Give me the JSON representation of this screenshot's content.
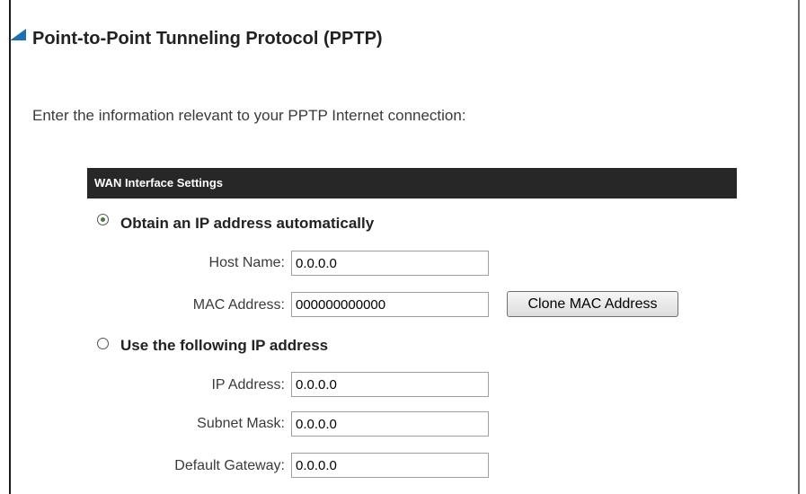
{
  "page": {
    "title": "Point-to-Point Tunneling Protocol (PPTP)",
    "intro": "Enter the information relevant to your PPTP Internet connection:"
  },
  "wan_settings": {
    "header": "WAN Interface Settings",
    "mode_options": [
      {
        "label": "Obtain an IP address automatically",
        "selected": true
      },
      {
        "label": "Use the following IP address",
        "selected": false
      }
    ],
    "auto_fields": {
      "host_name": {
        "label": "Host Name:",
        "value": "0.0.0.0"
      },
      "mac_address": {
        "label": "MAC Address:",
        "value": "000000000000"
      },
      "clone_button": "Clone MAC Address"
    },
    "static_fields": {
      "ip_address": {
        "label": "IP Address:",
        "value": "0.0.0.0"
      },
      "subnet_mask": {
        "label": "Subnet Mask:",
        "value": "0.0.0.0"
      },
      "default_gateway": {
        "label": "Default Gateway:",
        "value": "0.0.0.0"
      }
    }
  },
  "colors": {
    "section_bar": "#272727",
    "title_marker": "#1e6fb4",
    "radio_dot": "#4a7a3a"
  }
}
